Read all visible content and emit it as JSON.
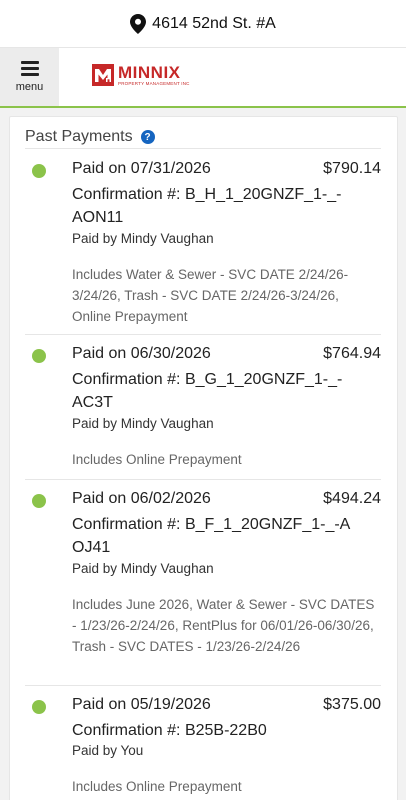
{
  "header": {
    "address": "4614 52nd St. #A",
    "address_icon": "map-pin-icon"
  },
  "nav": {
    "menu_label": "menu",
    "logo_text": "MINNIX",
    "logo_tagline": "PROPERTY MANAGEMENT INC"
  },
  "colors": {
    "accent_green": "#8bc34a",
    "brand_red": "#c62828",
    "help_blue": "#1565c0"
  },
  "payments_section": {
    "title": "Past Payments",
    "help_icon": "?",
    "items": [
      {
        "paid_on": "Paid on 07/31/2026",
        "amount": "$790.14",
        "confirmation": "Confirmation #: B_H_1_20GNZF_1-_-AON11",
        "paid_by": "Paid by Mindy Vaughan",
        "includes": "Includes Water & Sewer - SVC DATE 2/24/26-3/24/26, Trash - SVC DATE 2/24/26-3/24/26, Online Prepayment"
      },
      {
        "paid_on": "Paid on 06/30/2026",
        "amount": "$764.94",
        "confirmation": "Confirmation #: B_G_1_20GNZF_1-_-AC3T",
        "paid_by": "Paid by Mindy Vaughan",
        "includes": "Includes Online Prepayment"
      },
      {
        "paid_on": "Paid on 06/02/2026",
        "amount": "$494.24",
        "confirmation": "Confirmation #: B_F_1_20GNZF_1-_-AOJ41",
        "paid_by": "Paid by Mindy Vaughan",
        "includes": "Includes June 2026, Water & Sewer - SVC DATES - 1/23/26-2/24/26, RentPlus for 06/01/26-06/30/26, Trash - SVC DATES - 1/23/26-2/24/26"
      },
      {
        "paid_on": "Paid on 05/19/2026",
        "amount": "$375.00",
        "confirmation": "Confirmation #: B25B-22B0",
        "paid_by": "Paid by You",
        "includes": "Includes Online Prepayment"
      }
    ]
  }
}
